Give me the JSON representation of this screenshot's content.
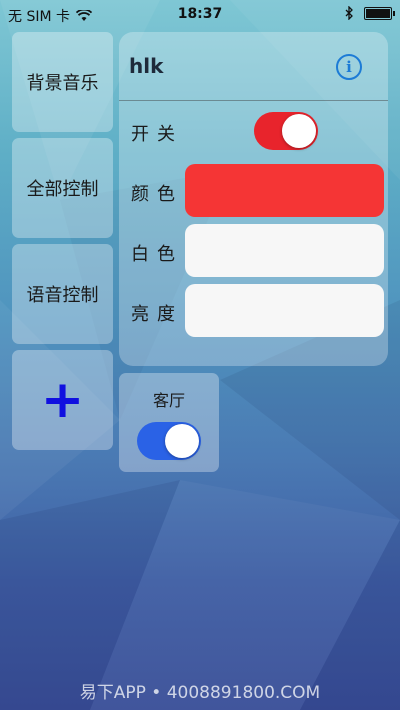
{
  "status_bar": {
    "carrier": "无 SIM 卡",
    "time": "18:37"
  },
  "sidebar": {
    "items": [
      {
        "label": "背景音乐"
      },
      {
        "label": "全部控制"
      },
      {
        "label": "语音控制"
      },
      {
        "label": "+"
      }
    ]
  },
  "device_panel": {
    "title": "hlk",
    "info_glyph": "i",
    "power": {
      "label": "开关",
      "on": true
    },
    "color": {
      "label": "颜色",
      "value": "#f53535"
    },
    "white": {
      "label": "白色",
      "value": "#f7f7f7"
    },
    "brightness": {
      "label": "亮度",
      "value": "#f7f7f7"
    }
  },
  "room": {
    "label": "客厅",
    "on": true
  },
  "watermark": "易下APP • 4008891800.COM",
  "colors": {
    "toggle_power": "#e8242c",
    "toggle_room": "#2a62e6",
    "add_icon": "#1010e0"
  }
}
